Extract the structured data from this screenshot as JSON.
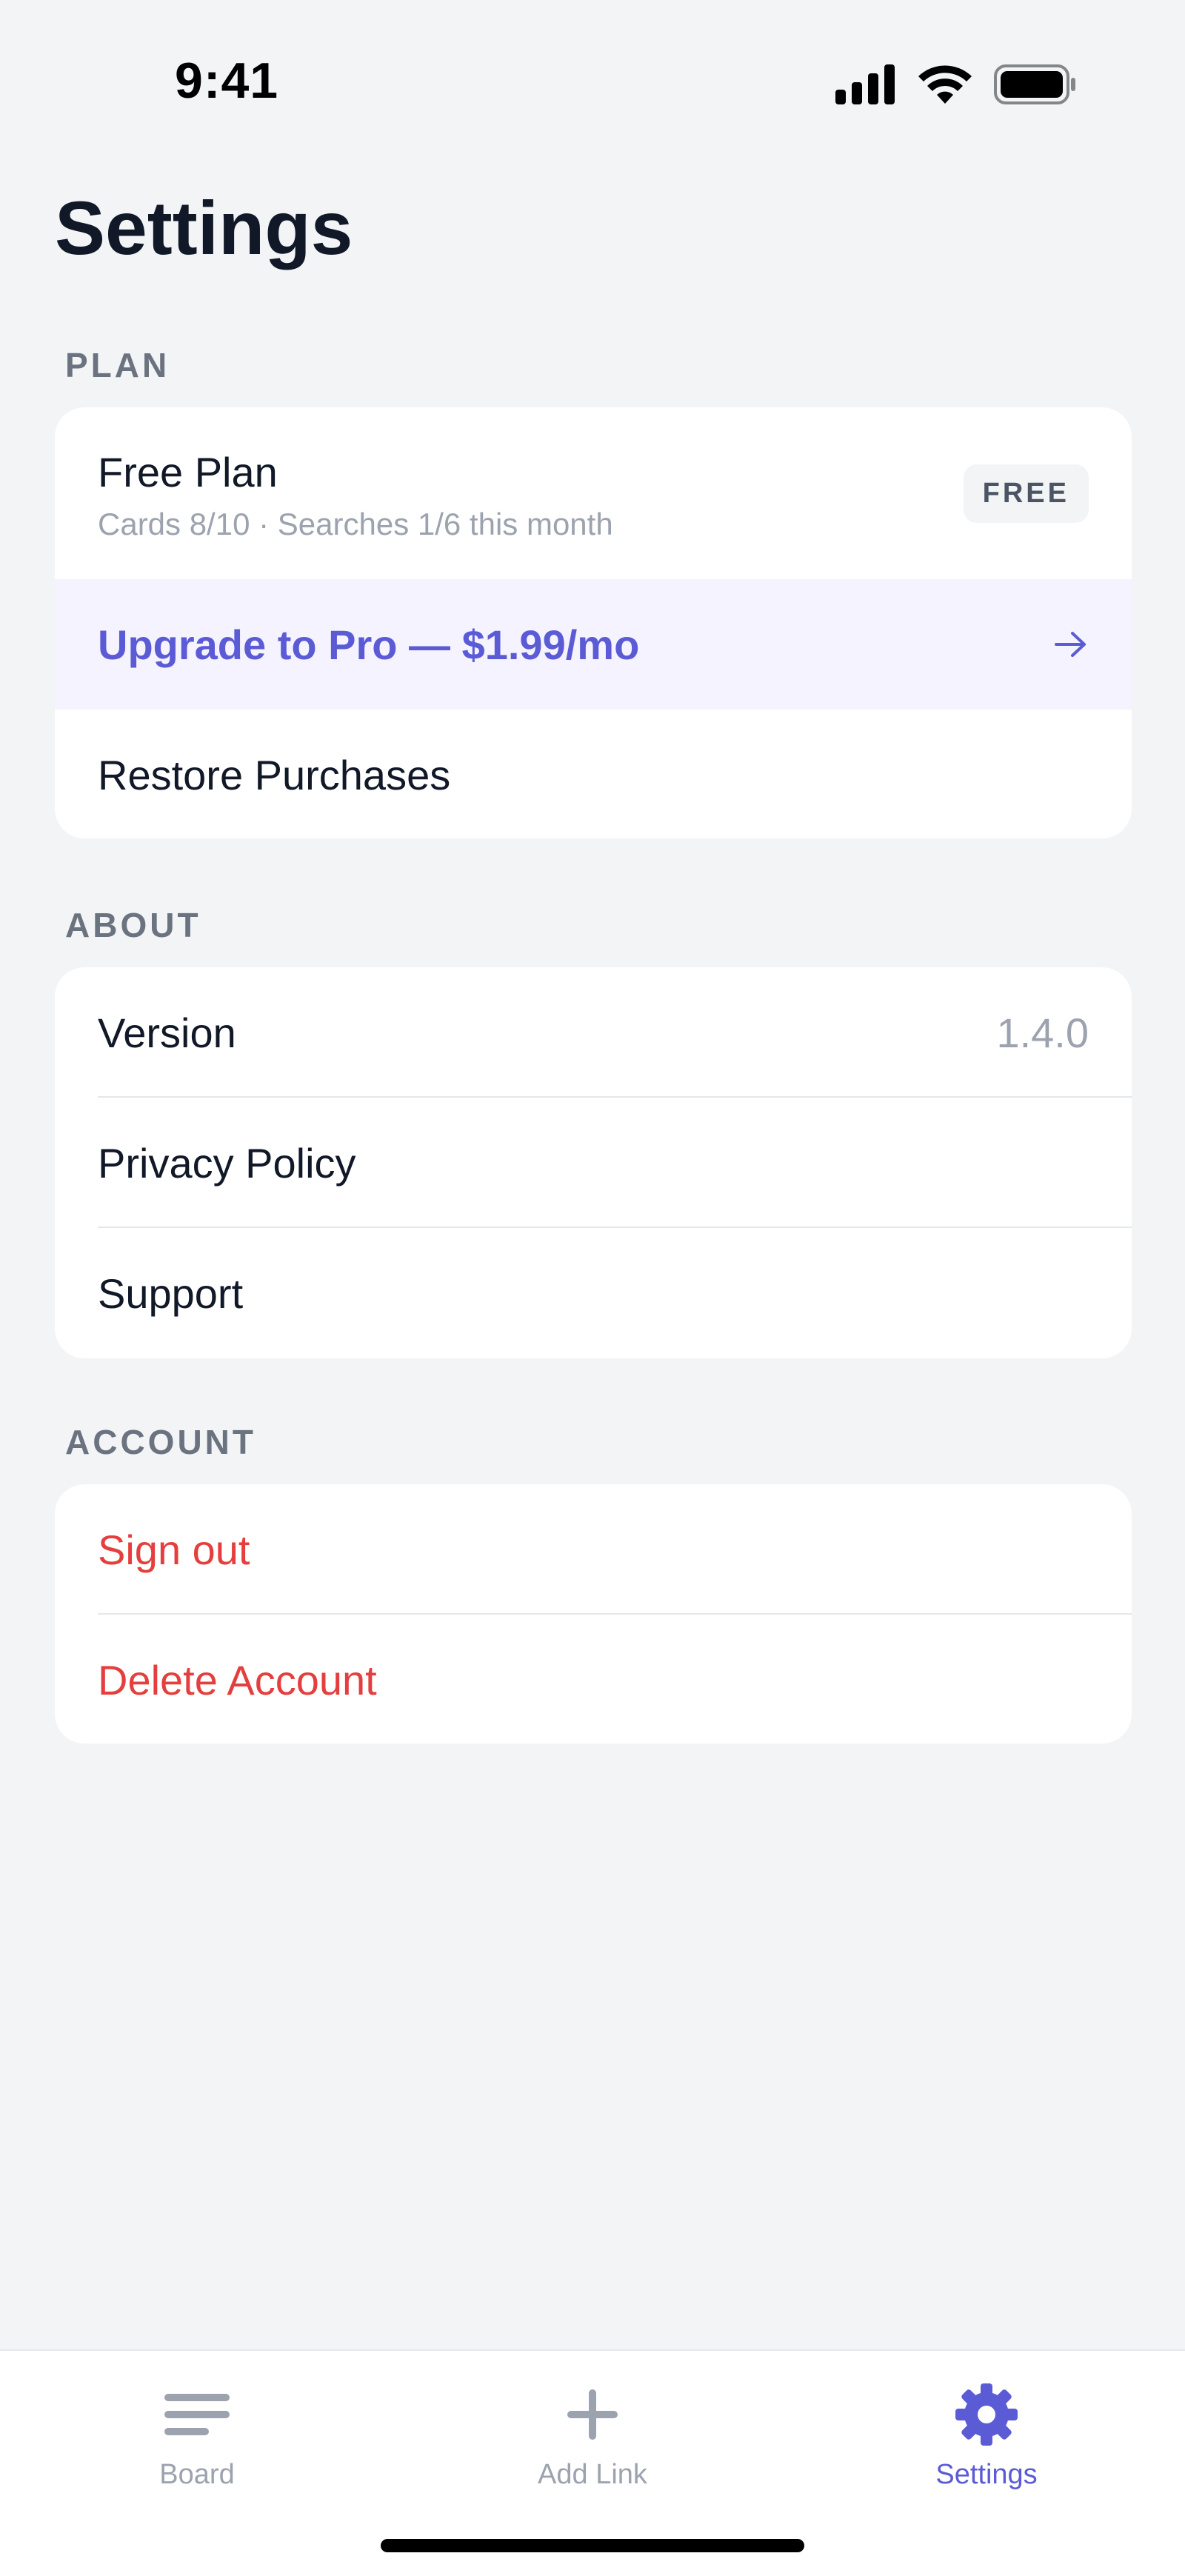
{
  "status_bar": {
    "time": "9:41",
    "icons": [
      "cellular-signal-icon",
      "wifi-icon",
      "battery-icon"
    ]
  },
  "page": {
    "title": "Settings"
  },
  "sections": {
    "plan": {
      "label": "PLAN",
      "plan_name": "Free Plan",
      "usage": "Cards 8/10 · Searches 1/6 this month",
      "badge": "FREE",
      "upgrade_label": "Upgrade to Pro — $1.99/mo",
      "restore_label": "Restore Purchases"
    },
    "about": {
      "label": "ABOUT",
      "version_label": "Version",
      "version_value": "1.4.0",
      "privacy_label": "Privacy Policy",
      "support_label": "Support"
    },
    "account": {
      "label": "ACCOUNT",
      "sign_out_label": "Sign out",
      "delete_label": "Delete Account"
    }
  },
  "tab_bar": {
    "tabs": [
      {
        "label": "Board",
        "icon": "lines-icon",
        "active": false
      },
      {
        "label": "Add Link",
        "icon": "plus-icon",
        "active": false
      },
      {
        "label": "Settings",
        "icon": "gear-icon",
        "active": true
      }
    ]
  },
  "colors": {
    "background": "#f3f4f6",
    "accent": "#5b5bd6",
    "upgrade_background": "#f5f3ff",
    "danger": "#e53e3e",
    "muted_text": "#9ca3af",
    "section_label": "#6b7280"
  }
}
